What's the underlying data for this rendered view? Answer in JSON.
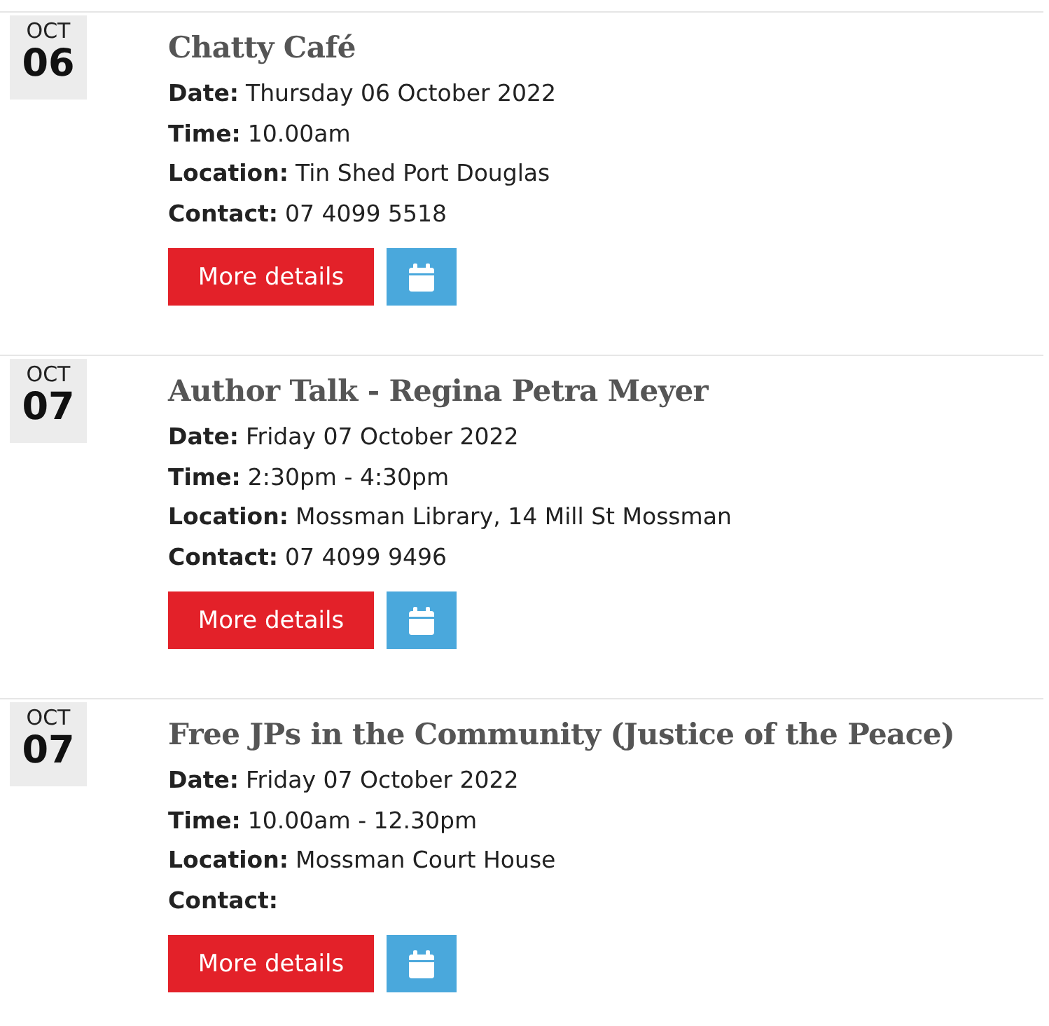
{
  "events": [
    {
      "month": "OCT",
      "day": "06",
      "title": "Chatty Café",
      "details": [
        {
          "label": "Date:",
          "value": "Thursday 06 October 2022"
        },
        {
          "label": "Time:",
          "value": "10.00am"
        },
        {
          "label": "Location:",
          "value": "Tin Shed Port Douglas"
        },
        {
          "label": "Contact:",
          "value": "07 4099 5518"
        }
      ],
      "button": "More details"
    },
    {
      "month": "OCT",
      "day": "07",
      "title": "Author Talk - Regina Petra Meyer",
      "details": [
        {
          "label": "Date:",
          "value": "Friday 07 October 2022"
        },
        {
          "label": "Time:",
          "value": "2:30pm - 4:30pm"
        },
        {
          "label": "Location:",
          "value": "Mossman Library, 14 Mill St Mossman"
        },
        {
          "label": "Contact:",
          "value": "07 4099 9496"
        }
      ],
      "button": "More details"
    },
    {
      "month": "OCT",
      "day": "07",
      "title": "Free JPs in the Community (Justice of the Peace)",
      "details": [
        {
          "label": "Date:",
          "value": "Friday 07 October 2022"
        },
        {
          "label": "Time:",
          "value": "10.00am - 12.30pm"
        },
        {
          "label": "Location:",
          "value": "Mossman Court House"
        },
        {
          "label": "Contact:"
        }
      ],
      "button": "More details"
    }
  ]
}
